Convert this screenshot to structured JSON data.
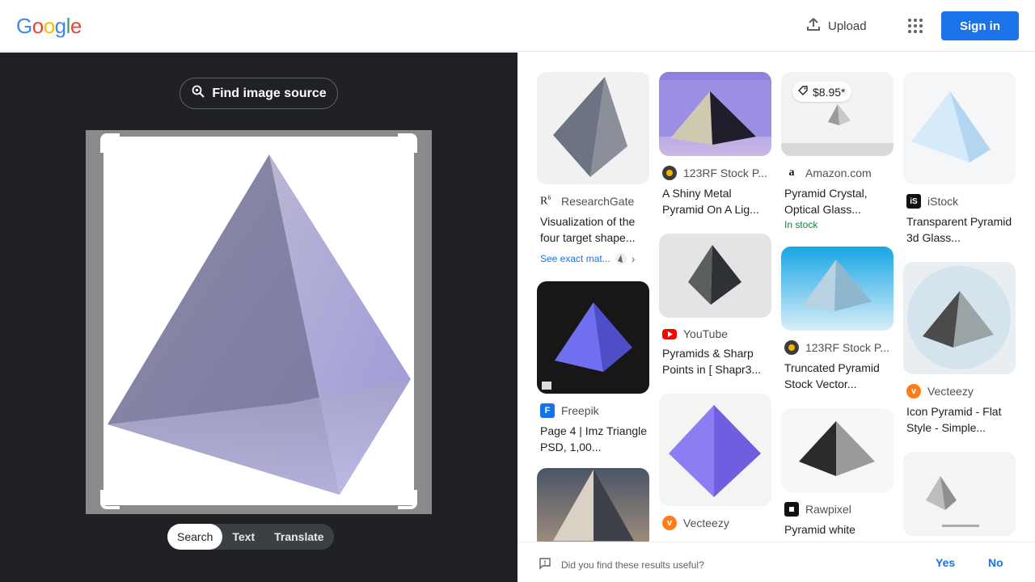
{
  "header": {
    "logo_letters": [
      "G",
      "o",
      "o",
      "g",
      "l",
      "e"
    ],
    "logo_colors": [
      "#4285f4",
      "#ea4335",
      "#fbbc05",
      "#4285f4",
      "#34a853",
      "#ea4335"
    ],
    "upload_label": "Upload",
    "signin_label": "Sign in",
    "accent": "#1a73e8"
  },
  "lens": {
    "find_source_label": "Find image source",
    "modes": [
      "Search",
      "Text",
      "Translate"
    ],
    "active_mode": "Search"
  },
  "results": {
    "col1": [
      {
        "source": "ResearchGate",
        "title": "Visualization of the four target shape...",
        "exact_label": "See exact mat..."
      },
      {
        "source": "Freepik",
        "title": "Page 4 | Imz Triangle PSD, 1,00..."
      }
    ],
    "col2": [
      {
        "source": "123RF Stock P...",
        "title": "A Shiny Metal Pyramid On A Lig..."
      },
      {
        "source": "YouTube",
        "title": "Pyramids & Sharp Points in [ Shapr3..."
      },
      {
        "source": "Vecteezy",
        "title": ""
      }
    ],
    "col3": [
      {
        "source": "Amazon.com",
        "title": "Pyramid Crystal, Optical Glass...",
        "price": "$8.95*",
        "stock": "In stock"
      },
      {
        "source": "123RF Stock P...",
        "title": "Truncated Pyramid Stock Vector..."
      },
      {
        "source": "Rawpixel",
        "title": "Pyramid white"
      }
    ],
    "col4": [
      {
        "source": "iStock",
        "title": "Transparent Pyramid 3d Glass..."
      },
      {
        "source": "Vecteezy",
        "title": "Icon Pyramid - Flat Style - Simple..."
      }
    ]
  },
  "feedback": {
    "question": "Did you find these results useful?",
    "yes": "Yes",
    "no": "No"
  }
}
